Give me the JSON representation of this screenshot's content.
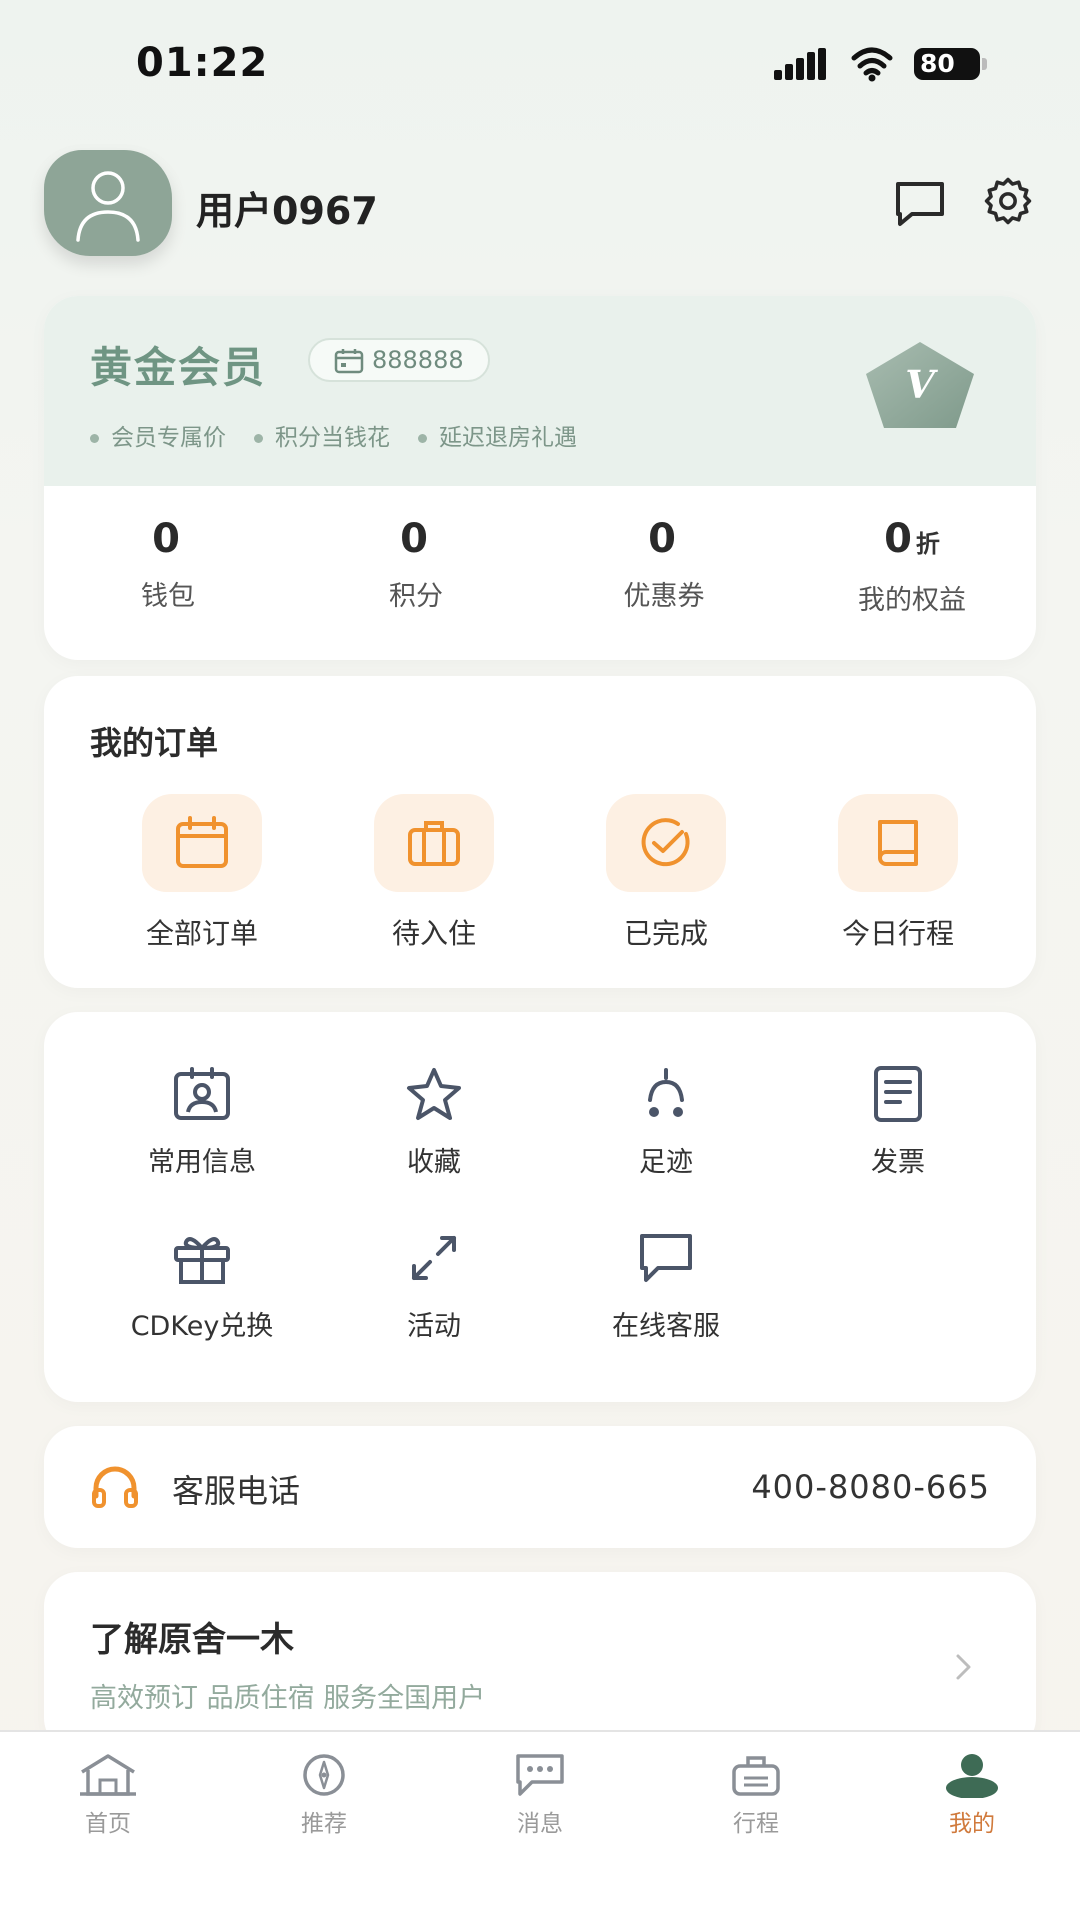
{
  "status_bar": {
    "time": "01:22",
    "battery": "80"
  },
  "header": {
    "username": "用户0967"
  },
  "member": {
    "level": "黄金会员",
    "card_number": "888888",
    "badge_letter": "V",
    "perks": [
      "会员专属价",
      "积分当钱花",
      "延迟退房礼遇"
    ],
    "stats": [
      {
        "value": "0",
        "unit": "",
        "label": "钱包"
      },
      {
        "value": "0",
        "unit": "",
        "label": "积分"
      },
      {
        "value": "0",
        "unit": "",
        "label": "优惠券"
      },
      {
        "value": "0",
        "unit": "折",
        "label": "我的权益"
      }
    ]
  },
  "orders": {
    "title": "我的订单",
    "items": [
      {
        "label": "全部订单",
        "icon": "calendar-icon"
      },
      {
        "label": "待入住",
        "icon": "suitcase-icon"
      },
      {
        "label": "已完成",
        "icon": "check-circle-icon"
      },
      {
        "label": "今日行程",
        "icon": "book-icon"
      }
    ]
  },
  "services": {
    "items": [
      {
        "label": "常用信息",
        "icon": "id-card-icon"
      },
      {
        "label": "收藏",
        "icon": "star-icon"
      },
      {
        "label": "足迹",
        "icon": "footprint-icon"
      },
      {
        "label": "发票",
        "icon": "invoice-icon"
      },
      {
        "label": "CDKey兑换",
        "icon": "gift-icon"
      },
      {
        "label": "活动",
        "icon": "expand-icon"
      },
      {
        "label": "在线客服",
        "icon": "chat-icon"
      }
    ]
  },
  "support": {
    "label": "客服电话",
    "phone": "400-8080-665"
  },
  "about": {
    "title": "了解原舍一木",
    "subtitle": "高效预订 品质住宿 服务全国用户"
  },
  "tabbar": {
    "active": "我的",
    "items": [
      {
        "label": "首页",
        "icon": "home-icon"
      },
      {
        "label": "推荐",
        "icon": "compass-icon"
      },
      {
        "label": "消息",
        "icon": "message-icon"
      },
      {
        "label": "行程",
        "icon": "luggage-icon"
      },
      {
        "label": "我的",
        "icon": "profile-icon"
      }
    ]
  },
  "colors": {
    "accent": "#f0922e",
    "brand_green": "#6f9583",
    "tab_active": "#d07a3c",
    "icon_slate": "#4b5568"
  }
}
